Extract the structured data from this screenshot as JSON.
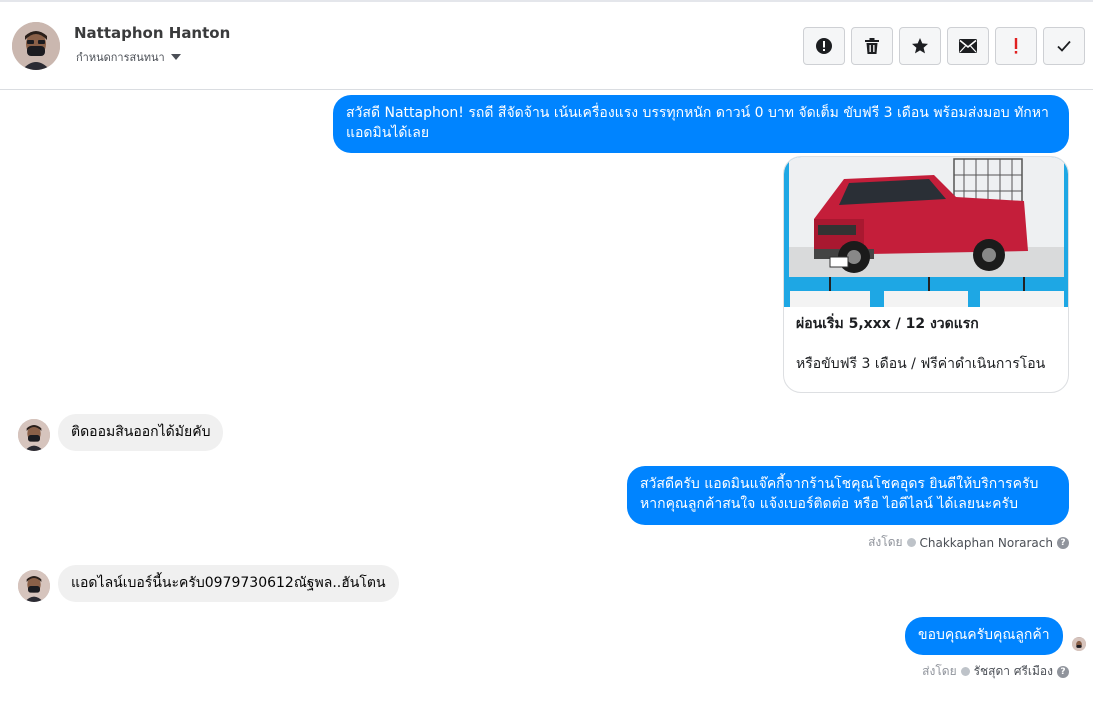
{
  "header": {
    "contact_name": "Nattaphon Hanton",
    "assign_label": "กำหนดการสนทนา",
    "toolbar": [
      {
        "icon": "alert-circle-icon",
        "color": "#1c1e21"
      },
      {
        "icon": "trash-icon",
        "color": "#1c1e21"
      },
      {
        "icon": "star-icon",
        "color": "#1c1e21"
      },
      {
        "icon": "envelope-icon",
        "color": "#1c1e21"
      },
      {
        "icon": "important-icon",
        "color": "#e02020",
        "glyph": "!"
      },
      {
        "icon": "check-icon",
        "color": "#1c1e21"
      }
    ]
  },
  "messages": {
    "m1": "สวัสดี Nattaphon! รถดี สีจัดจ้าน เน้นเครื่องแรง บรรทุกหนัก ดาวน์ 0 บาท จัดเต็ม ขับฟรี 3 เดือน พร้อมส่งมอบ ทักหาแอดมินได้เลย",
    "card_title": "ผ่อนเริ่ม 5,xxx / 12 งวดแรก",
    "card_desc": "หรือขับฟรี 3 เดือน / ฟรีค่าดำเนินการโอน",
    "m2": "ติดออมสินออกได้มัยคับ",
    "m3_line1": "สวัสดีครับ แอดมินแจ๊คกี้จากร้านโชคุณโชคอุดร ยินดีให้บริการครับ",
    "m3_line2": "หากคุณลูกค้าสนใจ แจ้งเบอร์ติดต่อ หรือ ไอดีไลน์ ได้เลยนะครับ",
    "m3_sent_label": "ส่งโดย",
    "m3_sent_by": "Chakkaphan Norarach",
    "m4": "แอดไลน์เบอร์นี้นะครับ0979730612ณัฐพล..ฮันโตน",
    "m5": "ขอบคุณครับคุณลูกค้า",
    "m5_sent_label": "ส่งโดย",
    "m5_sent_by": "รัชสุดา ศรีเมือง"
  },
  "colors": {
    "outgoing_bubble": "#0084ff",
    "incoming_bubble": "#f0f0f0",
    "car_red": "#c41e3a"
  }
}
